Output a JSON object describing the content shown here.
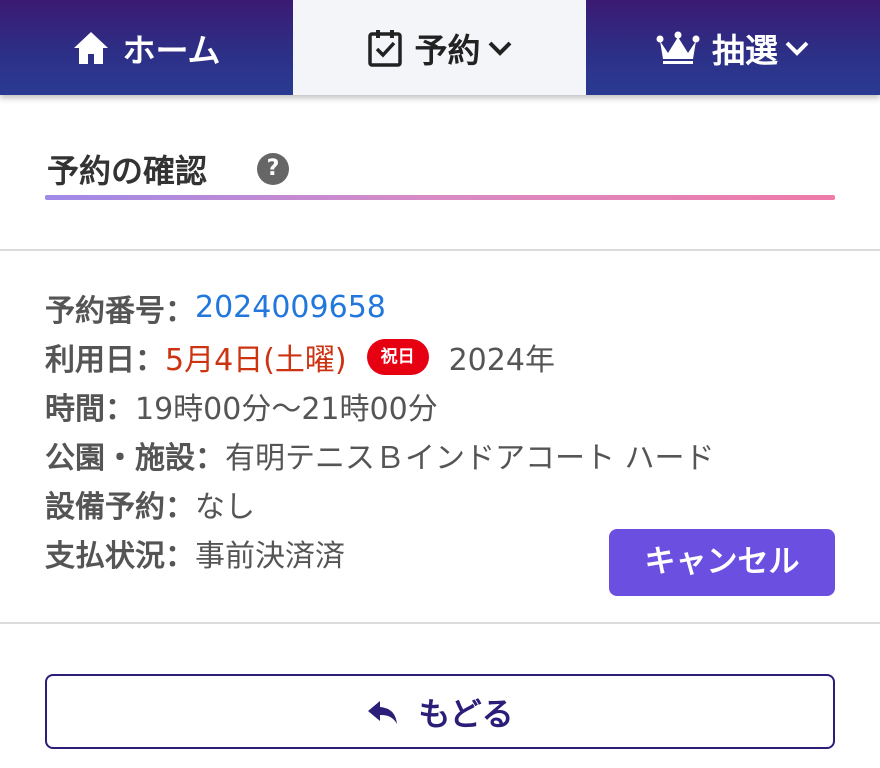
{
  "nav": {
    "home_label": "ホーム",
    "reserve_label": "予約",
    "lottery_label": "抽選"
  },
  "heading": {
    "title": "予約の確認",
    "help_icon": "?"
  },
  "reservation": {
    "number_label": "予約番号：",
    "number_value": "2024009658",
    "date_label": "利用日：",
    "date_value": "5月4日(土曜)",
    "holiday_badge": "祝日",
    "year_value": "2024年",
    "time_label": "時間：",
    "time_value": "19時00分～21時00分",
    "facility_label": "公園・施設：",
    "facility_value": "有明テニスＢインドアコート ハード",
    "equipment_label": "設備予約：",
    "equipment_value": "なし",
    "payment_label": "支払状況：",
    "payment_value": "事前決済済"
  },
  "actions": {
    "cancel_label": "キャンセル",
    "back_label": "もどる"
  },
  "icons": {
    "home": "home-icon",
    "reserve": "calendar-check-icon",
    "lottery": "crown-icon",
    "chevron": "chevron-down-icon",
    "help": "question-icon",
    "back": "reply-arrow-icon"
  },
  "colors": {
    "nav_bg": "#2d2f86",
    "active_tab_bg": "#f4f5f8",
    "reservation_number": "#2277dd",
    "date": "#cc3311",
    "holiday_badge": "#e60012",
    "cancel_button": "#6a4fe0",
    "back_button_border": "#2a1e78"
  }
}
